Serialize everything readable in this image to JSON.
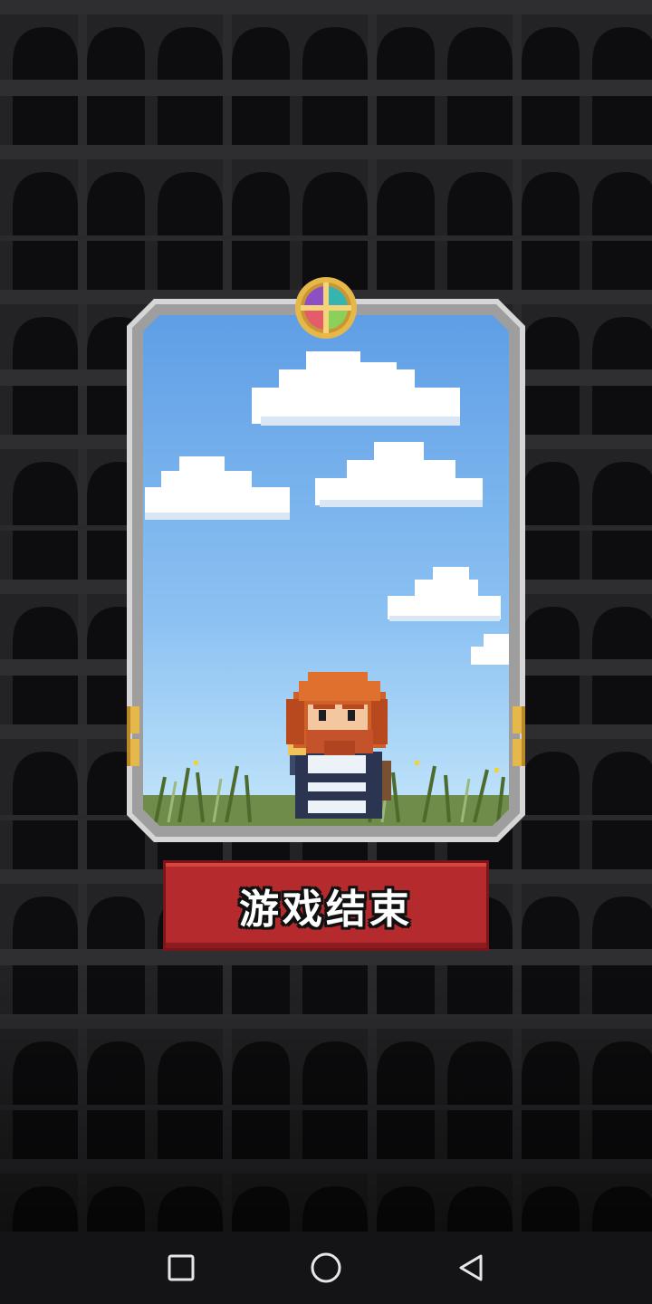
{
  "screen": {
    "game_over_label": "游戏结束"
  },
  "card": {
    "character": "red-bearded-warrior",
    "emblem": "quad-gem-emblem"
  },
  "navbar": {
    "recent_apps": "square-icon",
    "home": "circle-icon",
    "back": "triangle-back-icon"
  },
  "colors": {
    "background": "#1c1c1e",
    "sky_top": "#5f9ee6",
    "sky_bottom": "#b9e0fb",
    "button_red": "#b52a2c",
    "frame_silver": "#d6d6d6",
    "gold": "#e6b84a"
  }
}
